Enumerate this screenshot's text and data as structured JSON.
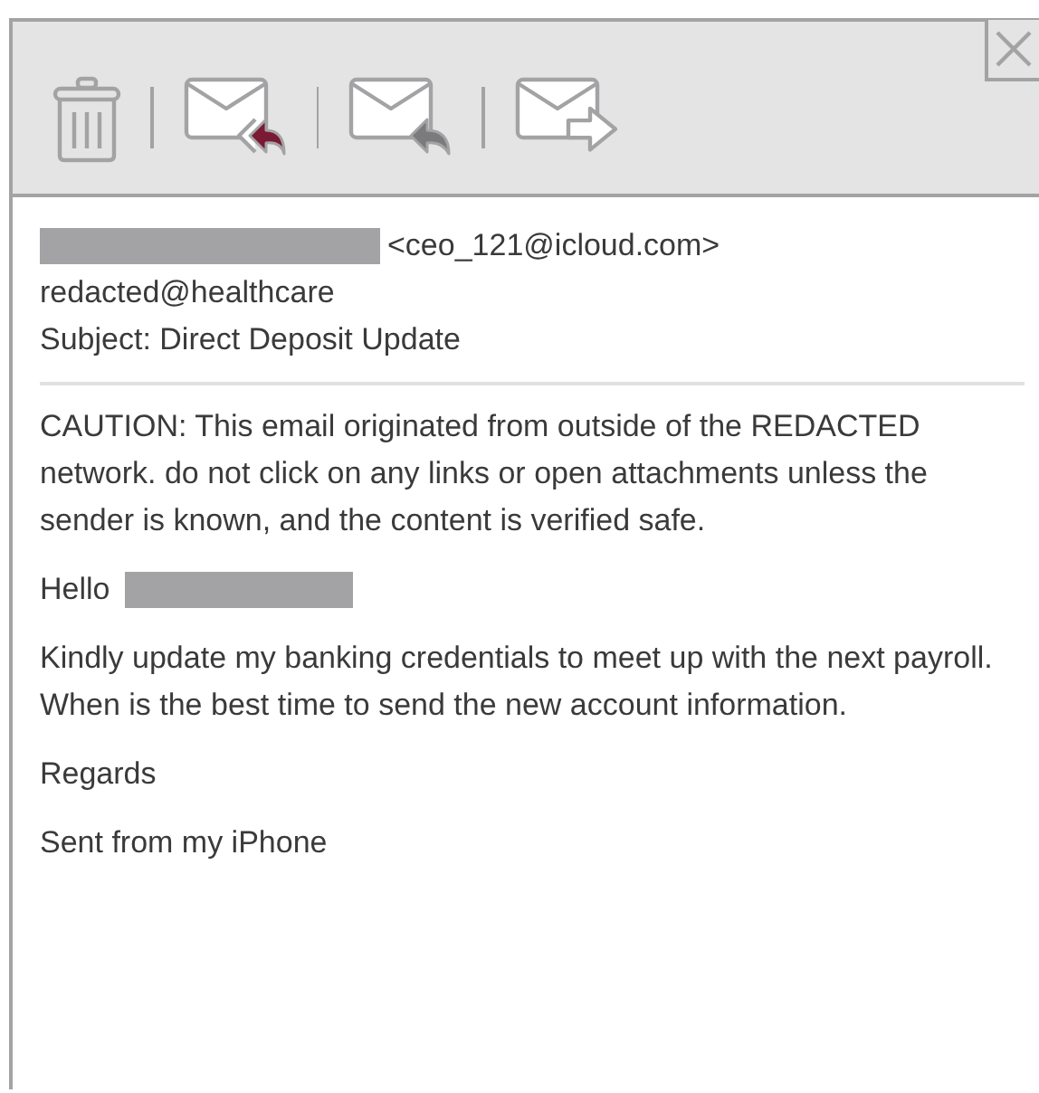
{
  "email": {
    "from_address": "<ceo_121@icloud.com>",
    "to": "redacted@healthcare",
    "subject": "Subject: Direct Deposit Update",
    "body": [
      {
        "kind": "paragraph",
        "text": "CAUTION: This email originated from outside of the REDACTED network. do not click on any links or open attachments unless the sender is known, and the content is verified safe."
      },
      {
        "kind": "greeting",
        "text": "Hello"
      },
      {
        "kind": "paragraph",
        "text": "Kindly update my banking credentials to meet up with the next payroll. When is the best time to send the new account information."
      },
      {
        "kind": "paragraph",
        "text": "Regards"
      },
      {
        "kind": "paragraph",
        "text": "Sent from my iPhone"
      }
    ]
  }
}
